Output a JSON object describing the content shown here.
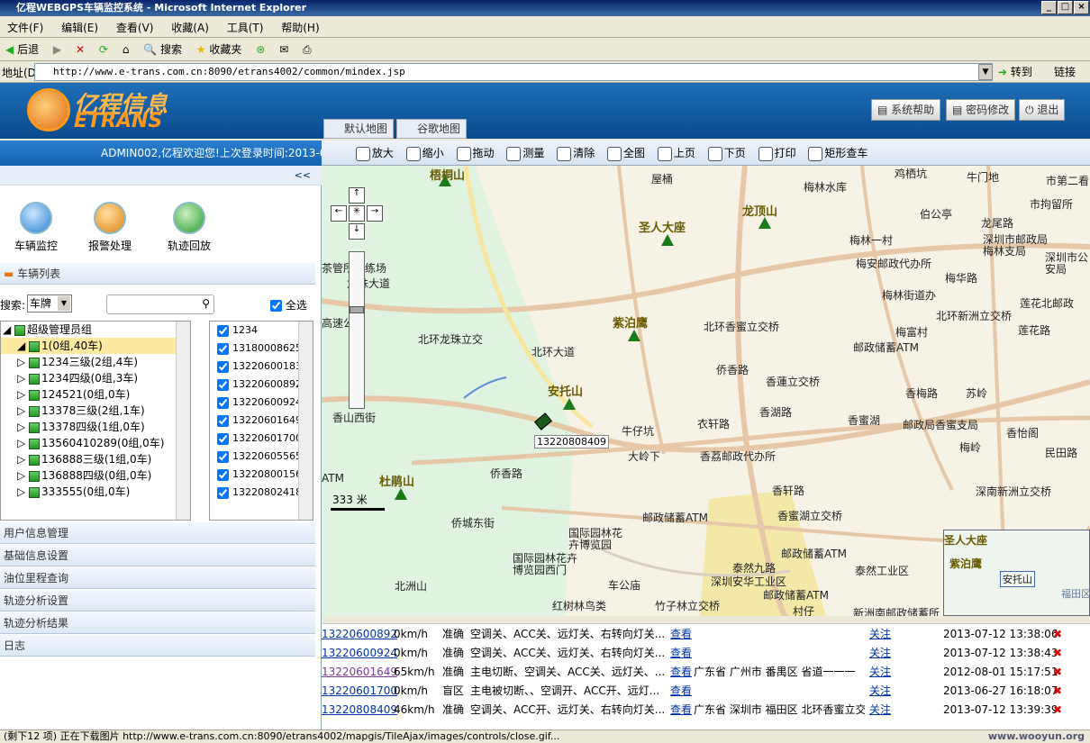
{
  "window": {
    "title": "亿程WEBGPS车辆监控系统 - Microsoft Internet Explorer"
  },
  "menu": [
    "文件(F)",
    "编辑(E)",
    "查看(V)",
    "收藏(A)",
    "工具(T)",
    "帮助(H)"
  ],
  "ie_toolbar": {
    "back": "后退",
    "search": "搜索",
    "favorites": "收藏夹"
  },
  "address": {
    "label": "地址(D)",
    "url": "http://www.e-trans.com.cn:8090/etrans4002/common/mindex.jsp",
    "go": "转到",
    "links": "链接"
  },
  "brand": {
    "name": "亿程信息",
    "sub": "ETRANS"
  },
  "header_buttons": {
    "help": "系统帮助",
    "password": "密码修改",
    "logout": "退出"
  },
  "map_tabs": {
    "default": "默认地图",
    "google": "谷歌地图"
  },
  "welcome": "ADMIN002,亿程欢迎您!上次登录时间:2013-07-",
  "map_tools": [
    "放大",
    "缩小",
    "拖动",
    "测量",
    "清除",
    "全图",
    "上页",
    "下页",
    "打印",
    "矩形查车"
  ],
  "left": {
    "collapse": "<<",
    "actions": [
      "车辆监控",
      "报警处理",
      "轨迹回放"
    ],
    "vehicle_list_title": "车辆列表",
    "search_label": "搜索:",
    "search_type": "车牌",
    "select_all": "全选",
    "tree": [
      "超级管理员组",
      "1(0组,40车)",
      "1234三级(2组,4车)",
      "1234四级(0组,3车)",
      "124521(0组,0车)",
      "13378三级(2组,1车)",
      "13378四级(1组,0车)",
      "13560410289(0组,0车)",
      "136888三级(1组,0车)",
      "136888四级(0组,0车)",
      "333555(0组,0车)"
    ],
    "vehicles": [
      "1234",
      "13180008625",
      "13220600183",
      "13220600892",
      "13220600924",
      "13220601649",
      "13220601700",
      "13220605565",
      "13220800156",
      "13220802418"
    ],
    "sections": [
      "用户信息管理",
      "基础信息设置",
      "油位里程查询",
      "轨迹分析设置",
      "轨迹分析结果",
      "日志"
    ]
  },
  "map": {
    "vehicle_label": "13220808409",
    "scale": "333 米",
    "mountains": [
      "梧桐山",
      "圣人大座",
      "龙顶山",
      "紫泊鹰",
      "安托山",
      "杜鹃山"
    ],
    "labels": [
      "屋桶",
      "梅林水库",
      "鸡栖坑",
      "牛门地",
      "市第二看",
      "市拘留所",
      "伯公亭",
      "龙尾路",
      "梅林一村",
      "深圳市邮政局梅林支局",
      "梅安邮政代办所",
      "梅华路",
      "深圳市公安局",
      "梅林街道办",
      "莲花北邮政",
      "北环新洲立交桥",
      "梅富村",
      "莲花路",
      "北环香蜜立交桥",
      "邮政储蓄ATM",
      "侨香路",
      "香蓮立交桥",
      "香梅路",
      "苏岭",
      "香湖路",
      "香蜜湖",
      "邮政局香蜜支局",
      "香怡阁",
      "衣轩路",
      "牛仔坑",
      "大岭下",
      "香荔邮政代办所",
      "梅岭",
      "民田路",
      "侨香路",
      "香轩路",
      "深南新洲立交桥",
      "香蜜湖立交桥",
      "邮政储蓄ATM",
      "侨城东街",
      "国际园林花卉博览园",
      "国际园林花卉博览园西门",
      "邮政储蓄ATM",
      "泰然九路",
      "泰然工业区",
      "深圳安华工业区",
      "车公庙",
      "邮政储蓄ATM",
      "北洲山",
      "红树林鸟类",
      "竹子林立交桥",
      "村仔",
      "新洲南邮政储蓄所",
      "茶管所训练场",
      "龙珠大道",
      "北环龙珠立交",
      "北环大道",
      "香山西街",
      "ATM",
      "高速公路"
    ],
    "minimap_labels": [
      "圣人大座",
      "紫泊鹰",
      "安托山",
      "福田区"
    ]
  },
  "results": [
    {
      "id": "13220600892",
      "speed": "0km/h",
      "status": "准确",
      "info": "空调关、ACC关、远灯关、右转向灯关...",
      "view": "查看",
      "loc": "",
      "follow": "关注",
      "time": "2013-07-12 13:38:06"
    },
    {
      "id": "13220600924",
      "speed": "0km/h",
      "status": "准确",
      "info": "空调关、ACC关、远灯关、右转向灯关...",
      "view": "查看",
      "loc": "",
      "follow": "关注",
      "time": "2013-07-12 13:38:43"
    },
    {
      "id": "13220601649",
      "speed": "65km/h",
      "status": "准确",
      "info": "主电切断、空调关、ACC关、远灯关、...",
      "view": "查看",
      "loc": "广东省 广州市 番禺区 省道一一一",
      "follow": "关注",
      "time": "2012-08-01 15:17:51"
    },
    {
      "id": "13220601700",
      "speed": "0km/h",
      "status": "盲区",
      "info": "主电被切断、、空调开、ACC开、远灯...",
      "view": "查看",
      "loc": "",
      "follow": "关注",
      "time": "2013-06-27 16:18:07"
    },
    {
      "id": "13220808409",
      "speed": "46km/h",
      "status": "准确",
      "info": "空调关、ACC开、远灯关、右转向灯关...",
      "view": "查看",
      "loc": "广东省 深圳市 福田区 北环香蜜立交",
      "follow": "关注",
      "time": "2013-07-12 13:39:39"
    }
  ],
  "status": "(剩下12 项) 正在下载图片 http://www.e-trans.com.cn:8090/etrans4002/mapgis/TileAjax/images/controls/close.gif...",
  "watermark": "www.wooyun.org"
}
